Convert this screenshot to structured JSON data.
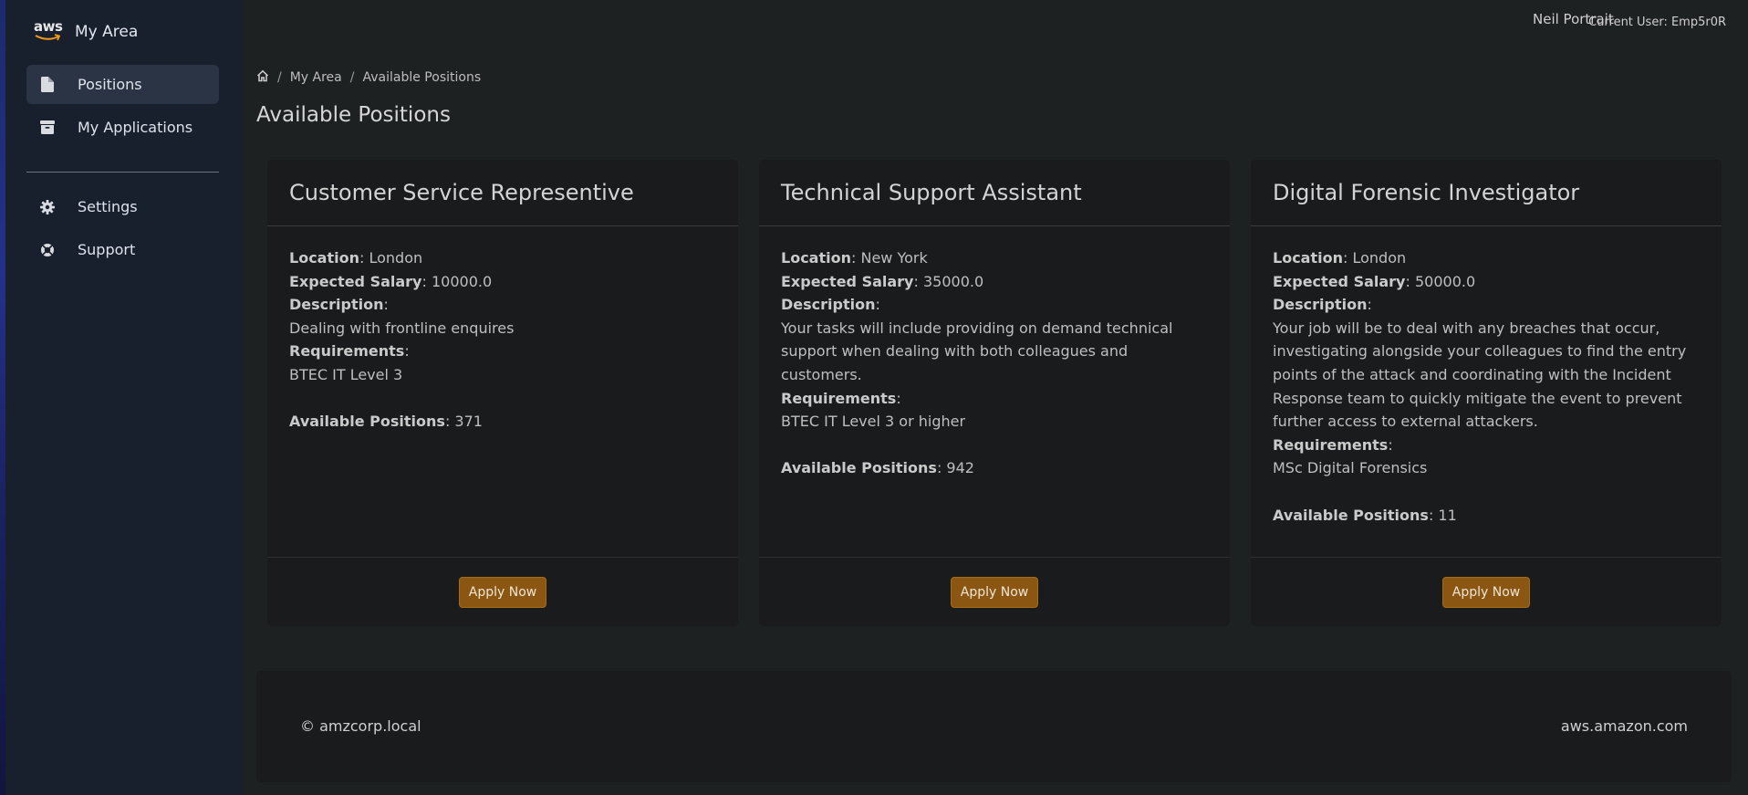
{
  "brand": {
    "logo_text": "aws",
    "name": "My Area"
  },
  "sidebar": {
    "items": [
      {
        "label": "Positions",
        "icon": "document-icon",
        "active": true
      },
      {
        "label": "My Applications",
        "icon": "archive-icon",
        "active": false
      },
      {
        "label": "Settings",
        "icon": "gear-icon",
        "active": false
      },
      {
        "label": "Support",
        "icon": "lifebuoy-icon",
        "active": false
      }
    ]
  },
  "header": {
    "user_name": "Neil Portrait",
    "current_user": "Current User: Emp5r0R"
  },
  "breadcrumb": {
    "home_icon": "home-icon",
    "items": [
      "My Area",
      "Available Positions"
    ],
    "separator": "/"
  },
  "page": {
    "title": "Available Positions"
  },
  "labels": {
    "location": "Location",
    "salary": "Expected Salary",
    "description": "Description",
    "requirements": "Requirements",
    "available": "Available Positions",
    "colon": ":",
    "apply": "Apply Now"
  },
  "positions": [
    {
      "title": "Customer Service Representive",
      "location": "London",
      "salary": "10000.0",
      "description": "Dealing with frontline enquires",
      "requirements": "BTEC IT Level 3",
      "available": "371"
    },
    {
      "title": "Technical Support Assistant",
      "location": "New York",
      "salary": "35000.0",
      "description": "Your tasks will include providing on demand technical support when dealing with both colleagues and customers.",
      "requirements": "BTEC IT Level 3 or higher",
      "available": "942"
    },
    {
      "title": "Digital Forensic Investigator",
      "location": "London",
      "salary": "50000.0",
      "description": "Your job will be to deal with any breaches that occur, investigating alongside your colleagues to find the entry points of the attack and coordinating with the Incident Response team to quickly mitigate the event to prevent further access to external attackers.",
      "requirements": "MSc Digital Forensics",
      "available": "11"
    }
  ],
  "footer": {
    "left": "© amzcorp.local",
    "right": "aws.amazon.com"
  },
  "colors": {
    "accent": "#8a5611",
    "sidebar": "#18202e",
    "background": "#1e2122",
    "card": "#1a1b1c"
  }
}
